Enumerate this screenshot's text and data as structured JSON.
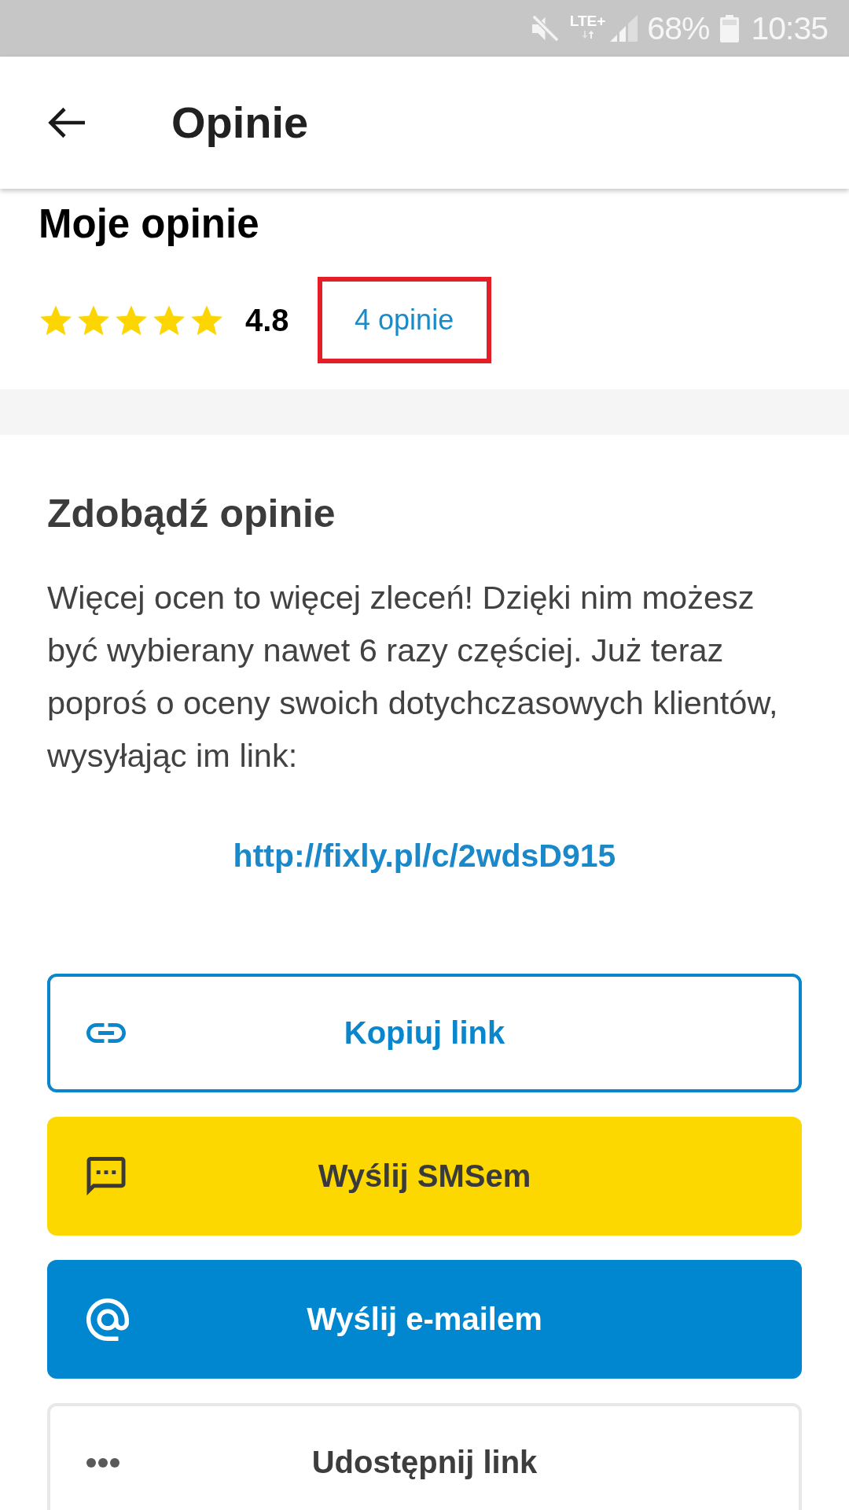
{
  "status_bar": {
    "network": "LTE+",
    "battery": "68%",
    "time": "10:35"
  },
  "app_bar": {
    "title": "Opinie"
  },
  "my_reviews": {
    "heading": "Moje opinie",
    "stars": 5,
    "rating": "4.8",
    "count_link": "4 opinie",
    "highlighted": true
  },
  "get_reviews": {
    "heading": "Zdobądź opinie",
    "description": "Więcej ocen to więcej zleceń! Dzięki nim możesz być wybierany nawet 6 razy częściej. Już teraz poproś o oceny swoich dotychczasowych klientów, wysyłając im link:",
    "link": "http://fixly.pl/c/2wdsD915"
  },
  "share_buttons": [
    {
      "kind": "copy",
      "label": "Kopiuj link"
    },
    {
      "kind": "sms",
      "label": "Wyślij SMSem"
    },
    {
      "kind": "email",
      "label": "Wyślij e-mailem"
    },
    {
      "kind": "share",
      "label": "Udostępnij link"
    }
  ]
}
